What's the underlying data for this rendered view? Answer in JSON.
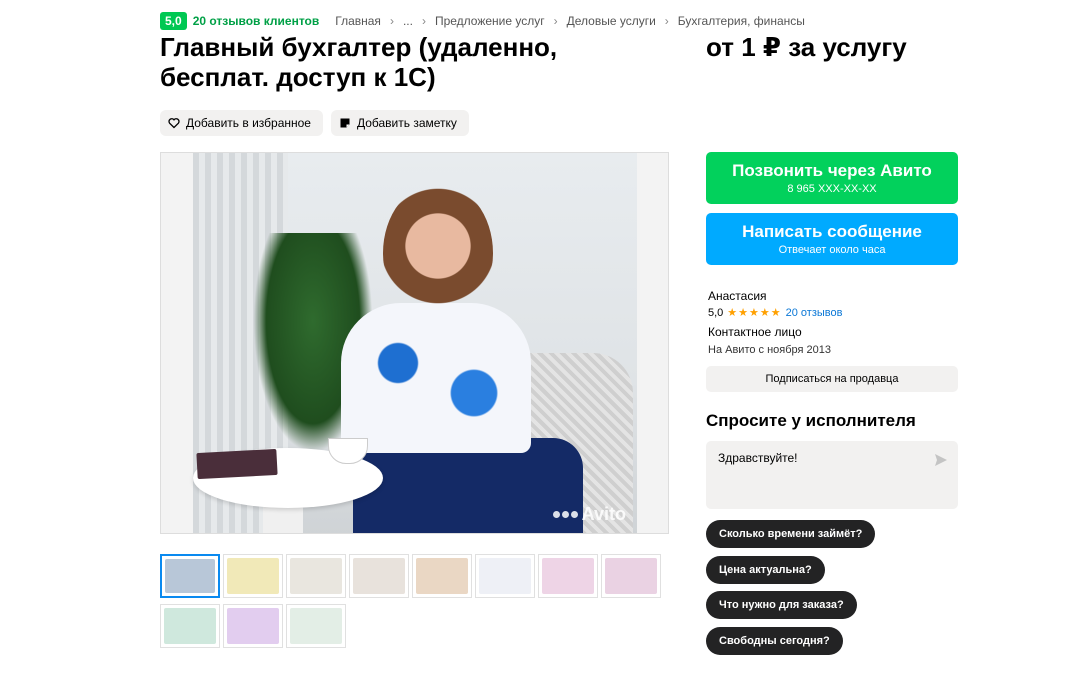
{
  "header": {
    "rating": "5,0",
    "reviews": "20 отзывов клиентов",
    "breadcrumbs": [
      "Главная",
      "...",
      "Предложение услуг",
      "Деловые услуги",
      "Бухгалтерия, финансы"
    ]
  },
  "listing": {
    "title_line1": "Главный бухгалтер (удаленно,",
    "title_line2": "бесплат. доступ к 1С)",
    "price": "от 1 ₽ за услугу",
    "favorite_label": "Добавить в избранное",
    "note_label": "Добавить заметку",
    "watermark": "Avito"
  },
  "thumbnails": [
    {
      "color": "#b8c7d8",
      "active": true
    },
    {
      "color": "#f1e9b8"
    },
    {
      "color": "#e9e6df"
    },
    {
      "color": "#e8e2dc"
    },
    {
      "color": "#ead7c4"
    },
    {
      "color": "#eef0f6"
    },
    {
      "color": "#eed4e6"
    },
    {
      "color": "#ead2e3"
    },
    {
      "color": "#cfe8dd"
    },
    {
      "color": "#e2cdef"
    },
    {
      "color": "#e3eee6"
    }
  ],
  "contact": {
    "call_label": "Позвонить через Авито",
    "phone": "8 965 XXX-XX-XX",
    "message_label": "Написать сообщение",
    "response_time": "Отвечает около часа",
    "call_color": "#02d15c",
    "message_color": "#00aaff"
  },
  "seller": {
    "name": "Анастасия",
    "rating": "5,0",
    "stars": "★★★★★",
    "reviews": "20 отзывов",
    "role": "Контактное лицо",
    "since": "На Авито с ноября 2013",
    "subscribe_label": "Подписаться на продавца"
  },
  "ask": {
    "title": "Спросите у исполнителя",
    "message": "Здравствуйте!",
    "chips": [
      "Сколько времени займёт?",
      "Цена актуальна?",
      "Что нужно для заказа?",
      "Свободны сегодня?"
    ]
  }
}
